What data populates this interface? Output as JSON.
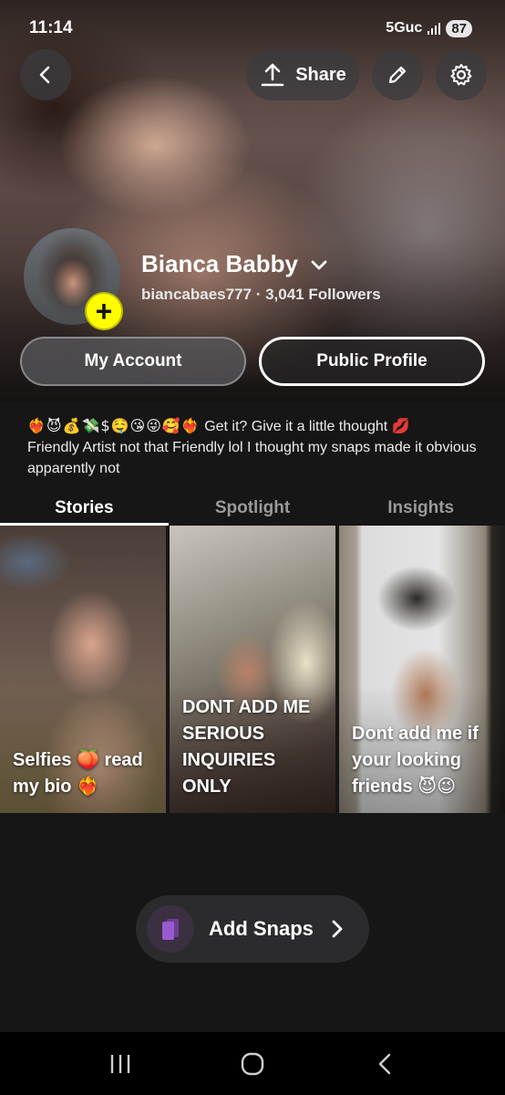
{
  "status_bar": {
    "time": "11:14",
    "network": "5Guc",
    "battery": "87"
  },
  "header": {
    "share_label": "Share"
  },
  "profile": {
    "display_name": "Bianca Babby",
    "username_line": "biancabaes777 · 3,041 Followers",
    "add_symbol": "+"
  },
  "actions": {
    "my_account": "My Account",
    "public_profile": "Public Profile"
  },
  "bio": {
    "emoji_line": "❤️‍🔥😈💰💸$🤤😘😜🥰❤️‍🔥",
    "text_line1": " Get it? Give it a little thought 💋",
    "text_rest": "Friendly Artist not that Friendly lol I thought my snaps made it obvious apparently not"
  },
  "tabs": [
    {
      "label": "Stories",
      "active": true
    },
    {
      "label": "Spotlight",
      "active": false
    },
    {
      "label": "Insights",
      "active": false
    }
  ],
  "stories": [
    {
      "caption": "Selfies 🍑 read my bio ❤️‍🔥"
    },
    {
      "caption": "DONT ADD ME SERIOUS INQUIRIES ONLY"
    },
    {
      "caption": "Dont add me if your looking friends 😈😉"
    }
  ],
  "add_snaps": {
    "label": "Add Snaps"
  },
  "colors": {
    "accent_yellow": "#fffc00",
    "background": "#161616",
    "snap_icon": "#9b59d0"
  }
}
